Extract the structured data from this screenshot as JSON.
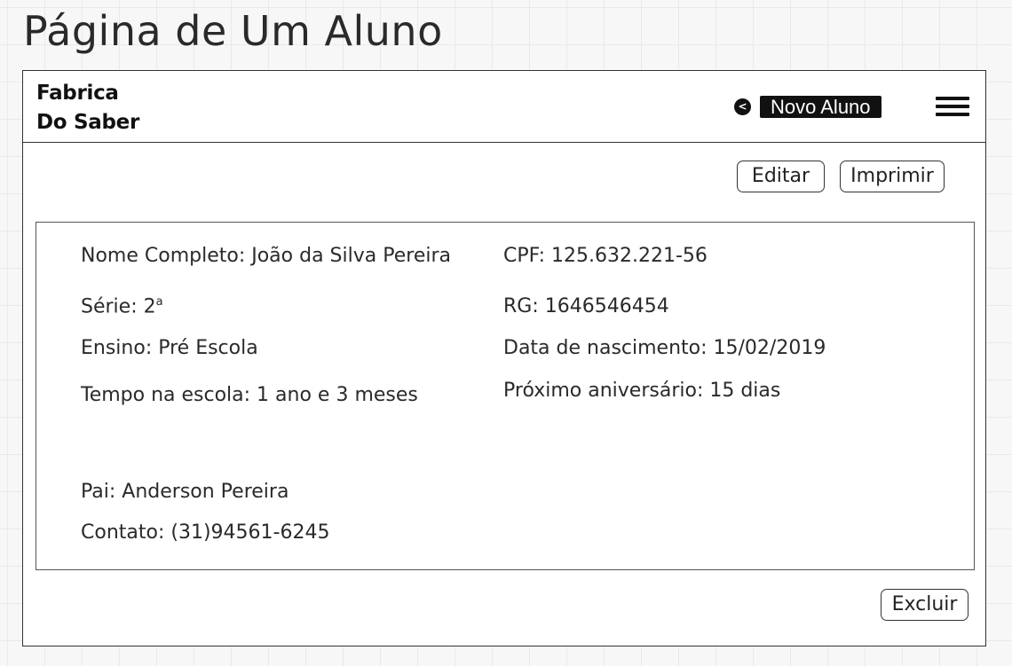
{
  "page_title": "Página de Um Aluno",
  "header": {
    "logo_line1": "Fabrica",
    "logo_line2": "Do Saber",
    "back_icon_glyph": "<",
    "new_student_label": "Novo Aluno"
  },
  "toolbar": {
    "edit_label": "Editar",
    "print_label": "Imprimir"
  },
  "student": {
    "full_name": "Nome Completo:  João da Silva Pereira",
    "grade_prefix": "Série: 2",
    "grade_sup": "a",
    "level": "Ensino: Pré Escola",
    "time_at_school": "Tempo na escola: 1 ano e 3 meses",
    "cpf": "CPF: 125.632.221-56",
    "rg": "RG: 1646546454",
    "birth_date": "Data de nascimento: 15/02/2019",
    "next_birthday": "Próximo aniversário: 15 dias",
    "father": "Pai: Anderson Pereira",
    "contact": "Contato: (31)94561-6245"
  },
  "footer": {
    "delete_label": "Excluir"
  },
  "icons": {
    "back": "back-circle-icon",
    "menu": "hamburger-menu-icon"
  },
  "colors": {
    "accent": "#111111",
    "border": "#333333",
    "background": "#f7f7f7"
  }
}
